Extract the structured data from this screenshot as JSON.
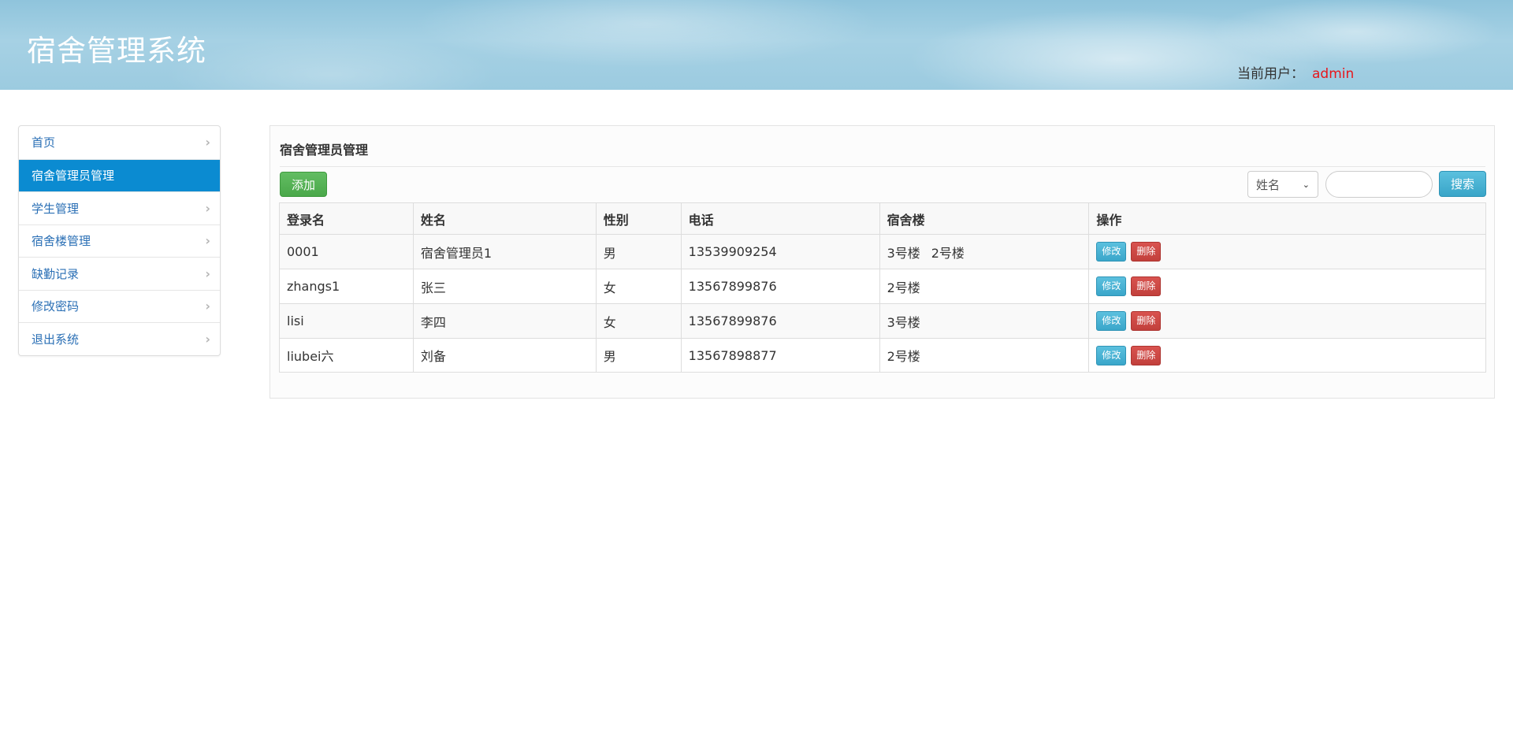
{
  "header": {
    "app_title": "宿舍管理系统",
    "user_label": "当前用户：",
    "user_name": "admin"
  },
  "sidebar": {
    "items": [
      {
        "label": "首页",
        "active": false
      },
      {
        "label": "宿舍管理员管理",
        "active": true
      },
      {
        "label": "学生管理",
        "active": false
      },
      {
        "label": "宿舍楼管理",
        "active": false
      },
      {
        "label": "缺勤记录",
        "active": false
      },
      {
        "label": "修改密码",
        "active": false
      },
      {
        "label": "退出系统",
        "active": false
      }
    ]
  },
  "main": {
    "title": "宿舍管理员管理",
    "add_label": "添加",
    "search": {
      "select_value": "姓名",
      "input_value": "",
      "button_label": "搜索"
    },
    "table": {
      "headers": [
        "登录名",
        "姓名",
        "性别",
        "电话",
        "宿舍楼",
        "操作"
      ],
      "rows": [
        {
          "login": "0001",
          "name": "宿舍管理员1",
          "gender": "男",
          "phone": "13539909254",
          "buildings": [
            "3号楼",
            "2号楼"
          ]
        },
        {
          "login": "zhangs1",
          "name": "张三",
          "gender": "女",
          "phone": "13567899876",
          "buildings": [
            "2号楼"
          ]
        },
        {
          "login": "lisi",
          "name": "李四",
          "gender": "女",
          "phone": "13567899876",
          "buildings": [
            "3号楼"
          ]
        },
        {
          "login": "liubei六",
          "name": "刘备",
          "gender": "男",
          "phone": "13567898877",
          "buildings": [
            "2号楼"
          ]
        }
      ],
      "edit_label": "修改",
      "delete_label": "删除"
    }
  },
  "colors": {
    "active_nav": "#0b8bd1",
    "user_name": "#e8151b",
    "add_button": "#5cb85c",
    "info_button": "#5bc0de",
    "danger_button": "#d9534f"
  }
}
